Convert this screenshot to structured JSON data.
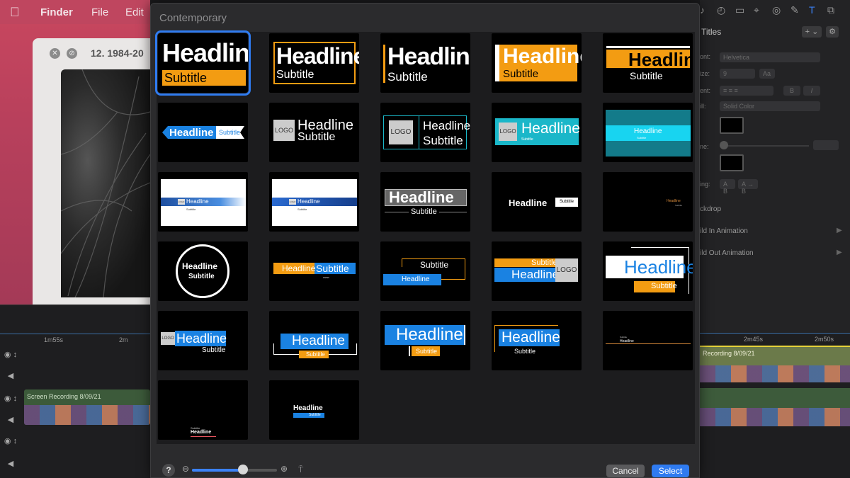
{
  "menubar": {
    "app": "Finder",
    "file": "File",
    "edit": "Edit"
  },
  "finder_window": {
    "title": "12. 1984-20"
  },
  "dialog": {
    "category": "Contemporary",
    "cancel_label": "Cancel",
    "select_label": "Select",
    "zoom_level": 0.6
  },
  "inspector": {
    "section_title": "Titles",
    "add_label": "+ ⌄",
    "font_label": "ont:",
    "font_value": "Helvetica",
    "size_label": "ize:",
    "size_value": "9",
    "size_step": "Aa",
    "align_label": "ent:",
    "bold": "B",
    "italic": "I",
    "fill_label": "ill:",
    "fill_value": "Solid Color",
    "line_label": "ne:",
    "spacing_label": "ing:",
    "spacing_a": "A B",
    "spacing_b": "A → B",
    "backdrop": "ckdrop",
    "build_in": "ild In Animation",
    "build_out": "ild Out Animation"
  },
  "timeline": {
    "left_ticks": [
      "1m55s",
      "2m"
    ],
    "right_ticks": [
      "2m45s",
      "2m50s"
    ],
    "clip_left": "Screen Recording 8/09/21",
    "clip_right": "Recording 8/09/21"
  },
  "templates": {
    "t1": {
      "headline": "Headline",
      "subtitle": "Subtitle"
    },
    "t2": {
      "headline": "Headline",
      "subtitle": "Subtitle"
    },
    "t3": {
      "headline": "Headline",
      "subtitle": "Subtitle"
    },
    "t4": {
      "headline": "Headline",
      "subtitle": "Subtitle"
    },
    "t5": {
      "headline": "Headline",
      "subtitle": "Subtitle"
    },
    "t6": {
      "headline": "Headline",
      "subtitle": "Subtitle"
    },
    "t7": {
      "logo": "LOGO",
      "headline": "Headline",
      "subtitle": "Subtitle"
    },
    "t8": {
      "logo": "LOGO",
      "headline": "Headline",
      "subtitle": "Subtitle"
    },
    "t9": {
      "logo": "LOGO",
      "headline": "Headline",
      "subtitle": "Subtitle"
    },
    "t10": {
      "headline": "Headline",
      "subtitle": "Subtitle"
    },
    "t11": {
      "logo": "LOGO",
      "headline": "Headline",
      "subtitle": "Subtitle"
    },
    "t12": {
      "logo": "LOGO",
      "headline": "Headline",
      "subtitle": "Subtitle"
    },
    "t13": {
      "headline": "Headline",
      "subtitle": "Subtitle"
    },
    "t14": {
      "headline": "Headline",
      "subtitle": "Subtitle"
    },
    "t15": {
      "headline": "Headline",
      "subtitle": "Subtitle"
    },
    "t16": {
      "headline": "Headline",
      "subtitle": "Subtitle"
    },
    "t17": {
      "headline": "Headline",
      "subtitle": "Subtitle",
      "extra": "www"
    },
    "t18": {
      "headline": "Headline",
      "subtitle": "Subtitle"
    },
    "t19": {
      "logo": "LOGO",
      "headline": "Headline",
      "subtitle": "Subtitle"
    },
    "t20": {
      "headline": "Headline",
      "subtitle": "Subtitle"
    },
    "t21": {
      "logo": "LOGO",
      "headline": "Headline",
      "subtitle": "Subtitle"
    },
    "t22": {
      "headline": "Headline",
      "subtitle": "Subtitle"
    },
    "t23": {
      "headline": "Headline",
      "subtitle": "Subtitle"
    },
    "t24": {
      "headline": "Headline",
      "subtitle": "Subtitle"
    },
    "t25": {
      "headline": "Headline",
      "subtitle": "Subtitle"
    },
    "t26": {
      "headline": "Headline",
      "subtitle": "Subtitle"
    },
    "t27": {
      "headline": "Headline",
      "subtitle": "Subtitle"
    }
  },
  "colors": {
    "accent_blue": "#2f7bf0",
    "title_blue": "#1a82e2",
    "orange": "#f39c12",
    "teal": "#1ab7c9"
  }
}
